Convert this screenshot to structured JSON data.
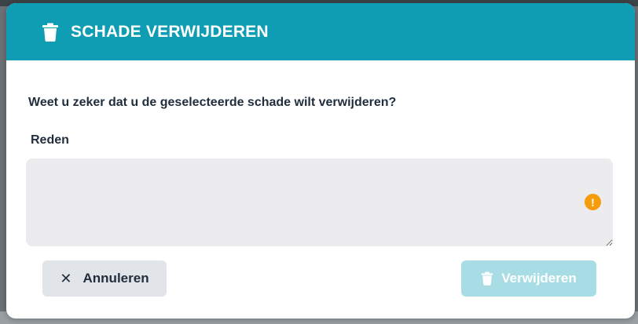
{
  "dialog": {
    "title": "SCHADE VERWIJDEREN",
    "header_icon": "trash-icon",
    "header_color": "#0e9db3",
    "question": "Weet u zeker dat u de geselecteerde schade wilt verwijderen?",
    "reason_label": "Reden",
    "reason_value": "",
    "reason_status_icon": "warning-icon",
    "warning_color": "#f59c0b"
  },
  "buttons": {
    "cancel_icon": "close-icon",
    "cancel_label": "Annuleren",
    "delete_icon": "trash-icon",
    "delete_label": "Verwijderen",
    "delete_disabled": true
  }
}
